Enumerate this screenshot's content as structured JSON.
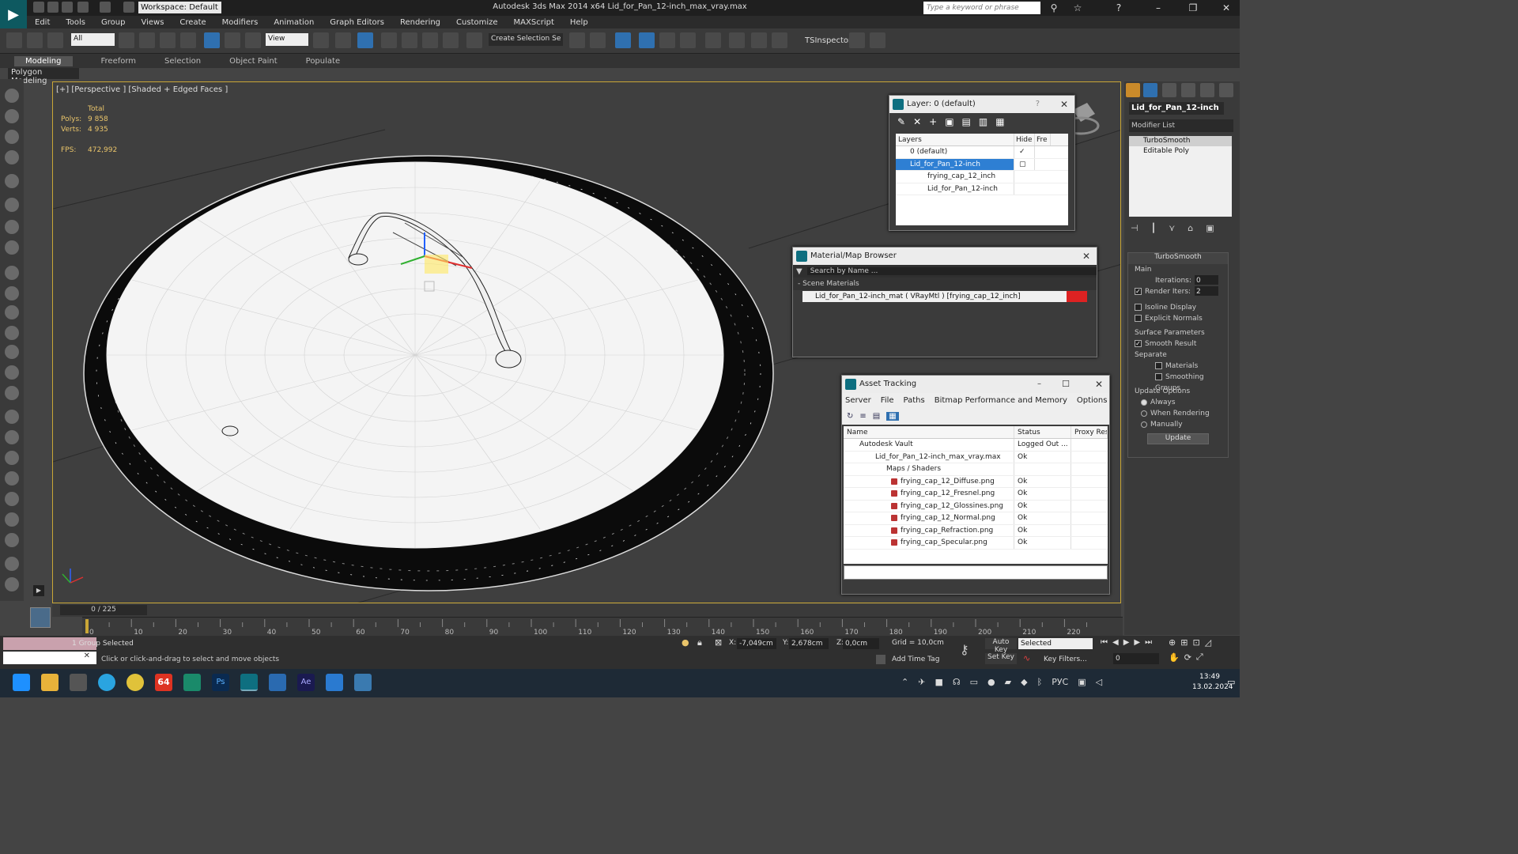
{
  "app": {
    "title": "Autodesk 3ds Max  2014 x64     Lid_for_Pan_12-inch_max_vray.max",
    "workspace": "Workspace: Default",
    "search_placeholder": "Type a keyword or phrase",
    "menus": [
      "Edit",
      "Tools",
      "Group",
      "Views",
      "Create",
      "Modifiers",
      "Animation",
      "Graph Editors",
      "Rendering",
      "Customize",
      "MAXScript",
      "Help"
    ]
  },
  "toolbar": {
    "filter": "All",
    "ref_coord": "View",
    "selection_set": "Create Selection Se",
    "tsinspector": "TSInspector"
  },
  "ribbon": {
    "tabs": [
      "Modeling",
      "Freeform",
      "Selection",
      "Object Paint",
      "Populate"
    ],
    "panel": "Polygon Modeling"
  },
  "viewport": {
    "label": "[+] [Perspective ] [Shaded + Edged Faces ]",
    "stats": {
      "total_label": "Total",
      "polys_label": "Polys:",
      "polys": "9 858",
      "verts_label": "Verts:",
      "verts": "4 935",
      "fps_label": "FPS:",
      "fps": "472,992"
    }
  },
  "layer_dialog": {
    "title": "Layer: 0 (default)",
    "help": "?",
    "columns": [
      "Layers",
      "Hide",
      "Fre"
    ],
    "rows": [
      "0 (default)",
      "Lid_for_Pan_12-inch",
      "frying_cap_12_inch",
      "Lid_for_Pan_12-inch"
    ]
  },
  "material_browser": {
    "title": "Material/Map Browser",
    "search_placeholder": "Search by Name ...",
    "section": "- Scene Materials",
    "item": "Lid_for_Pan_12-inch_mat  ( VRayMtl )  [frying_cap_12_inch]"
  },
  "asset_tracking": {
    "title": "Asset Tracking",
    "menus": [
      "Server",
      "File",
      "Paths",
      "Bitmap Performance and Memory",
      "Options"
    ],
    "columns": [
      "Name",
      "Status",
      "Proxy Res"
    ],
    "rows": [
      {
        "name": "Autodesk Vault",
        "status": "Logged Out ..."
      },
      {
        "name": "Lid_for_Pan_12-inch_max_vray.max",
        "status": "Ok"
      },
      {
        "name": "Maps / Shaders",
        "status": ""
      },
      {
        "name": "frying_cap_12_Diffuse.png",
        "status": "Ok"
      },
      {
        "name": "frying_cap_12_Fresnel.png",
        "status": "Ok"
      },
      {
        "name": "frying_cap_12_Glossines.png",
        "status": "Ok"
      },
      {
        "name": "frying_cap_12_Normal.png",
        "status": "Ok"
      },
      {
        "name": "frying_cap_Refraction.png",
        "status": "Ok"
      },
      {
        "name": "frying_cap_Specular.png",
        "status": "Ok"
      }
    ]
  },
  "command_panel": {
    "object_name": "Lid_for_Pan_12-inch",
    "modifier_list": "Modifier List",
    "stack": [
      "TurboSmooth",
      "Editable Poly"
    ],
    "turbosmooth": {
      "title": "TurboSmooth",
      "main": "Main",
      "iterations_label": "Iterations:",
      "iterations": "0",
      "render_iters_label": "Render Iters:",
      "render_iters": "2",
      "isoline": "Isoline Display",
      "explicit_normals": "Explicit Normals",
      "surface_params": "Surface Parameters",
      "smooth_result": "Smooth Result",
      "separate": "Separate",
      "materials": "Materials",
      "smoothing_groups": "Smoothing Groups",
      "update_options": "Update Options",
      "always": "Always",
      "when_rendering": "When Rendering",
      "manually": "Manually",
      "update": "Update"
    }
  },
  "timeline": {
    "slider": "0 / 225",
    "ticks": [
      "0",
      "10",
      "20",
      "30",
      "40",
      "50",
      "60",
      "70",
      "80",
      "90",
      "100",
      "110",
      "120",
      "130",
      "140",
      "150",
      "160",
      "170",
      "180",
      "190",
      "200",
      "210",
      "220"
    ]
  },
  "status": {
    "selected": "1 Group Selected",
    "prompt": "Click or click-and-drag to select and move objects",
    "x_label": "X:",
    "x": "-7,049cm",
    "y_label": "Y:",
    "y": "2,678cm",
    "z_label": "Z:",
    "z": "0,0cm",
    "grid": "Grid = 10,0cm",
    "add_time_tag": "Add Time Tag",
    "auto_key": "Auto Key",
    "auto_key_mode": "Selected",
    "set_key": "Set Key",
    "key_filters": "Key Filters...",
    "frame": "0"
  },
  "taskbar": {
    "lang": "РУС",
    "time": "13:49",
    "date": "13.02.2024",
    "badge": "64"
  }
}
